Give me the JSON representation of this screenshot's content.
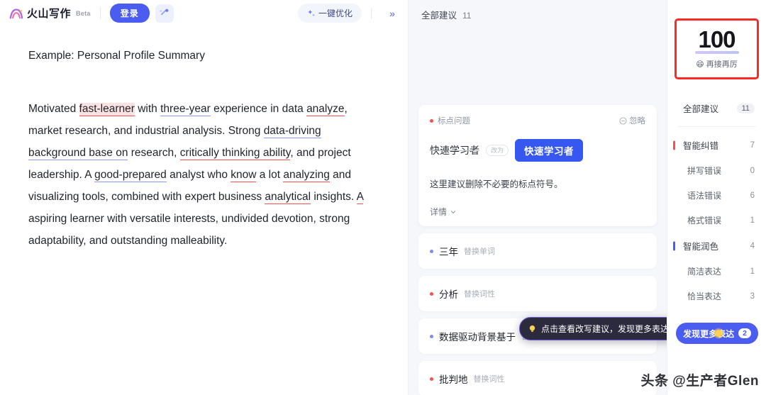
{
  "header": {
    "logo_text": "火山写作",
    "beta_badge": "Beta",
    "login_label": "登录",
    "magic_icon": "magic-wand-icon",
    "optimize_label": "一键优化",
    "optimize_icon": "sparkle-icon",
    "collapse_icon": "double-chevron-right-icon"
  },
  "document": {
    "title": "Example: Personal Profile Summary",
    "paragraph_segments": [
      {
        "text": "Motivated ",
        "mark": "none"
      },
      {
        "text": "fast-learner",
        "mark": "red-highlight"
      },
      {
        "text": " with ",
        "mark": "none"
      },
      {
        "text": "three-year",
        "mark": "blue"
      },
      {
        "text": " experience in data ",
        "mark": "none"
      },
      {
        "text": "analyze",
        "mark": "red"
      },
      {
        "text": ", market research, and industrial analysis. Strong ",
        "mark": "none"
      },
      {
        "text": "data-driving background base on",
        "mark": "blue"
      },
      {
        "text": " research, ",
        "mark": "none"
      },
      {
        "text": "critically thinking ability",
        "mark": "red"
      },
      {
        "text": ", and project leadership. A ",
        "mark": "none"
      },
      {
        "text": "good-prepared",
        "mark": "blue"
      },
      {
        "text": " analyst who ",
        "mark": "none"
      },
      {
        "text": "know",
        "mark": "red"
      },
      {
        "text": " a lot ",
        "mark": "none"
      },
      {
        "text": "analyzing",
        "mark": "red"
      },
      {
        "text": " and visualizing tools, combined with expert business ",
        "mark": "none"
      },
      {
        "text": "analytical",
        "mark": "red"
      },
      {
        "text": " insights. ",
        "mark": "none"
      },
      {
        "text": "A",
        "mark": "red"
      },
      {
        "text": " aspiring learner with versatile interests, undivided devotion, strong adaptability, and outstanding malleability.",
        "mark": "none"
      }
    ]
  },
  "suggestions": {
    "header_label": "全部建议",
    "header_count": "11",
    "expanded_card": {
      "tag": "标点问题",
      "ignore_label": "忽略",
      "ignore_icon": "minus-circle-icon",
      "old_word": "快速学习者",
      "arrow_label": "改为",
      "new_word": "快速学习者",
      "note": "这里建议删除不必要的标点符号。",
      "detail_label": "详情",
      "detail_icon": "chevron-down-icon"
    },
    "rows": [
      {
        "word": "三年",
        "tag": "替换单词",
        "dot": "blue"
      },
      {
        "word": "分析",
        "tag": "替换词性",
        "dot": "red"
      },
      {
        "word": "数据驱动背景基于",
        "tag": "替换单词",
        "dot": "blue"
      },
      {
        "word": "批判地",
        "tag": "替换词性",
        "dot": "red"
      }
    ],
    "tooltip": {
      "text": "点击查看改写建议，发现更多表达",
      "icon": "lightbulb-icon"
    }
  },
  "score_panel": {
    "score": "100",
    "score_caption": "再接再厉",
    "score_emoji": "😄",
    "all_label": "全部建议",
    "all_count": "11",
    "categories": [
      {
        "name": "智能纠错",
        "count": "7",
        "marker": "red",
        "sub": false
      },
      {
        "name": "拼写错误",
        "count": "0",
        "marker": "none",
        "sub": true
      },
      {
        "name": "语法错误",
        "count": "6",
        "marker": "none",
        "sub": true
      },
      {
        "name": "格式错误",
        "count": "1",
        "marker": "none",
        "sub": true
      },
      {
        "name": "智能润色",
        "count": "4",
        "marker": "blue",
        "sub": false
      },
      {
        "name": "简洁表达",
        "count": "1",
        "marker": "none",
        "sub": true
      },
      {
        "name": "恰当表达",
        "count": "3",
        "marker": "none",
        "sub": true
      }
    ],
    "more_button": {
      "label": "发现更多表达",
      "count": "2"
    }
  },
  "watermark": "头条 @生产者Glen",
  "colors": {
    "primary": "#4b5cf0",
    "error": "#f5514f",
    "polish": "#7b8cf2",
    "score_border": "#fa2b27"
  }
}
